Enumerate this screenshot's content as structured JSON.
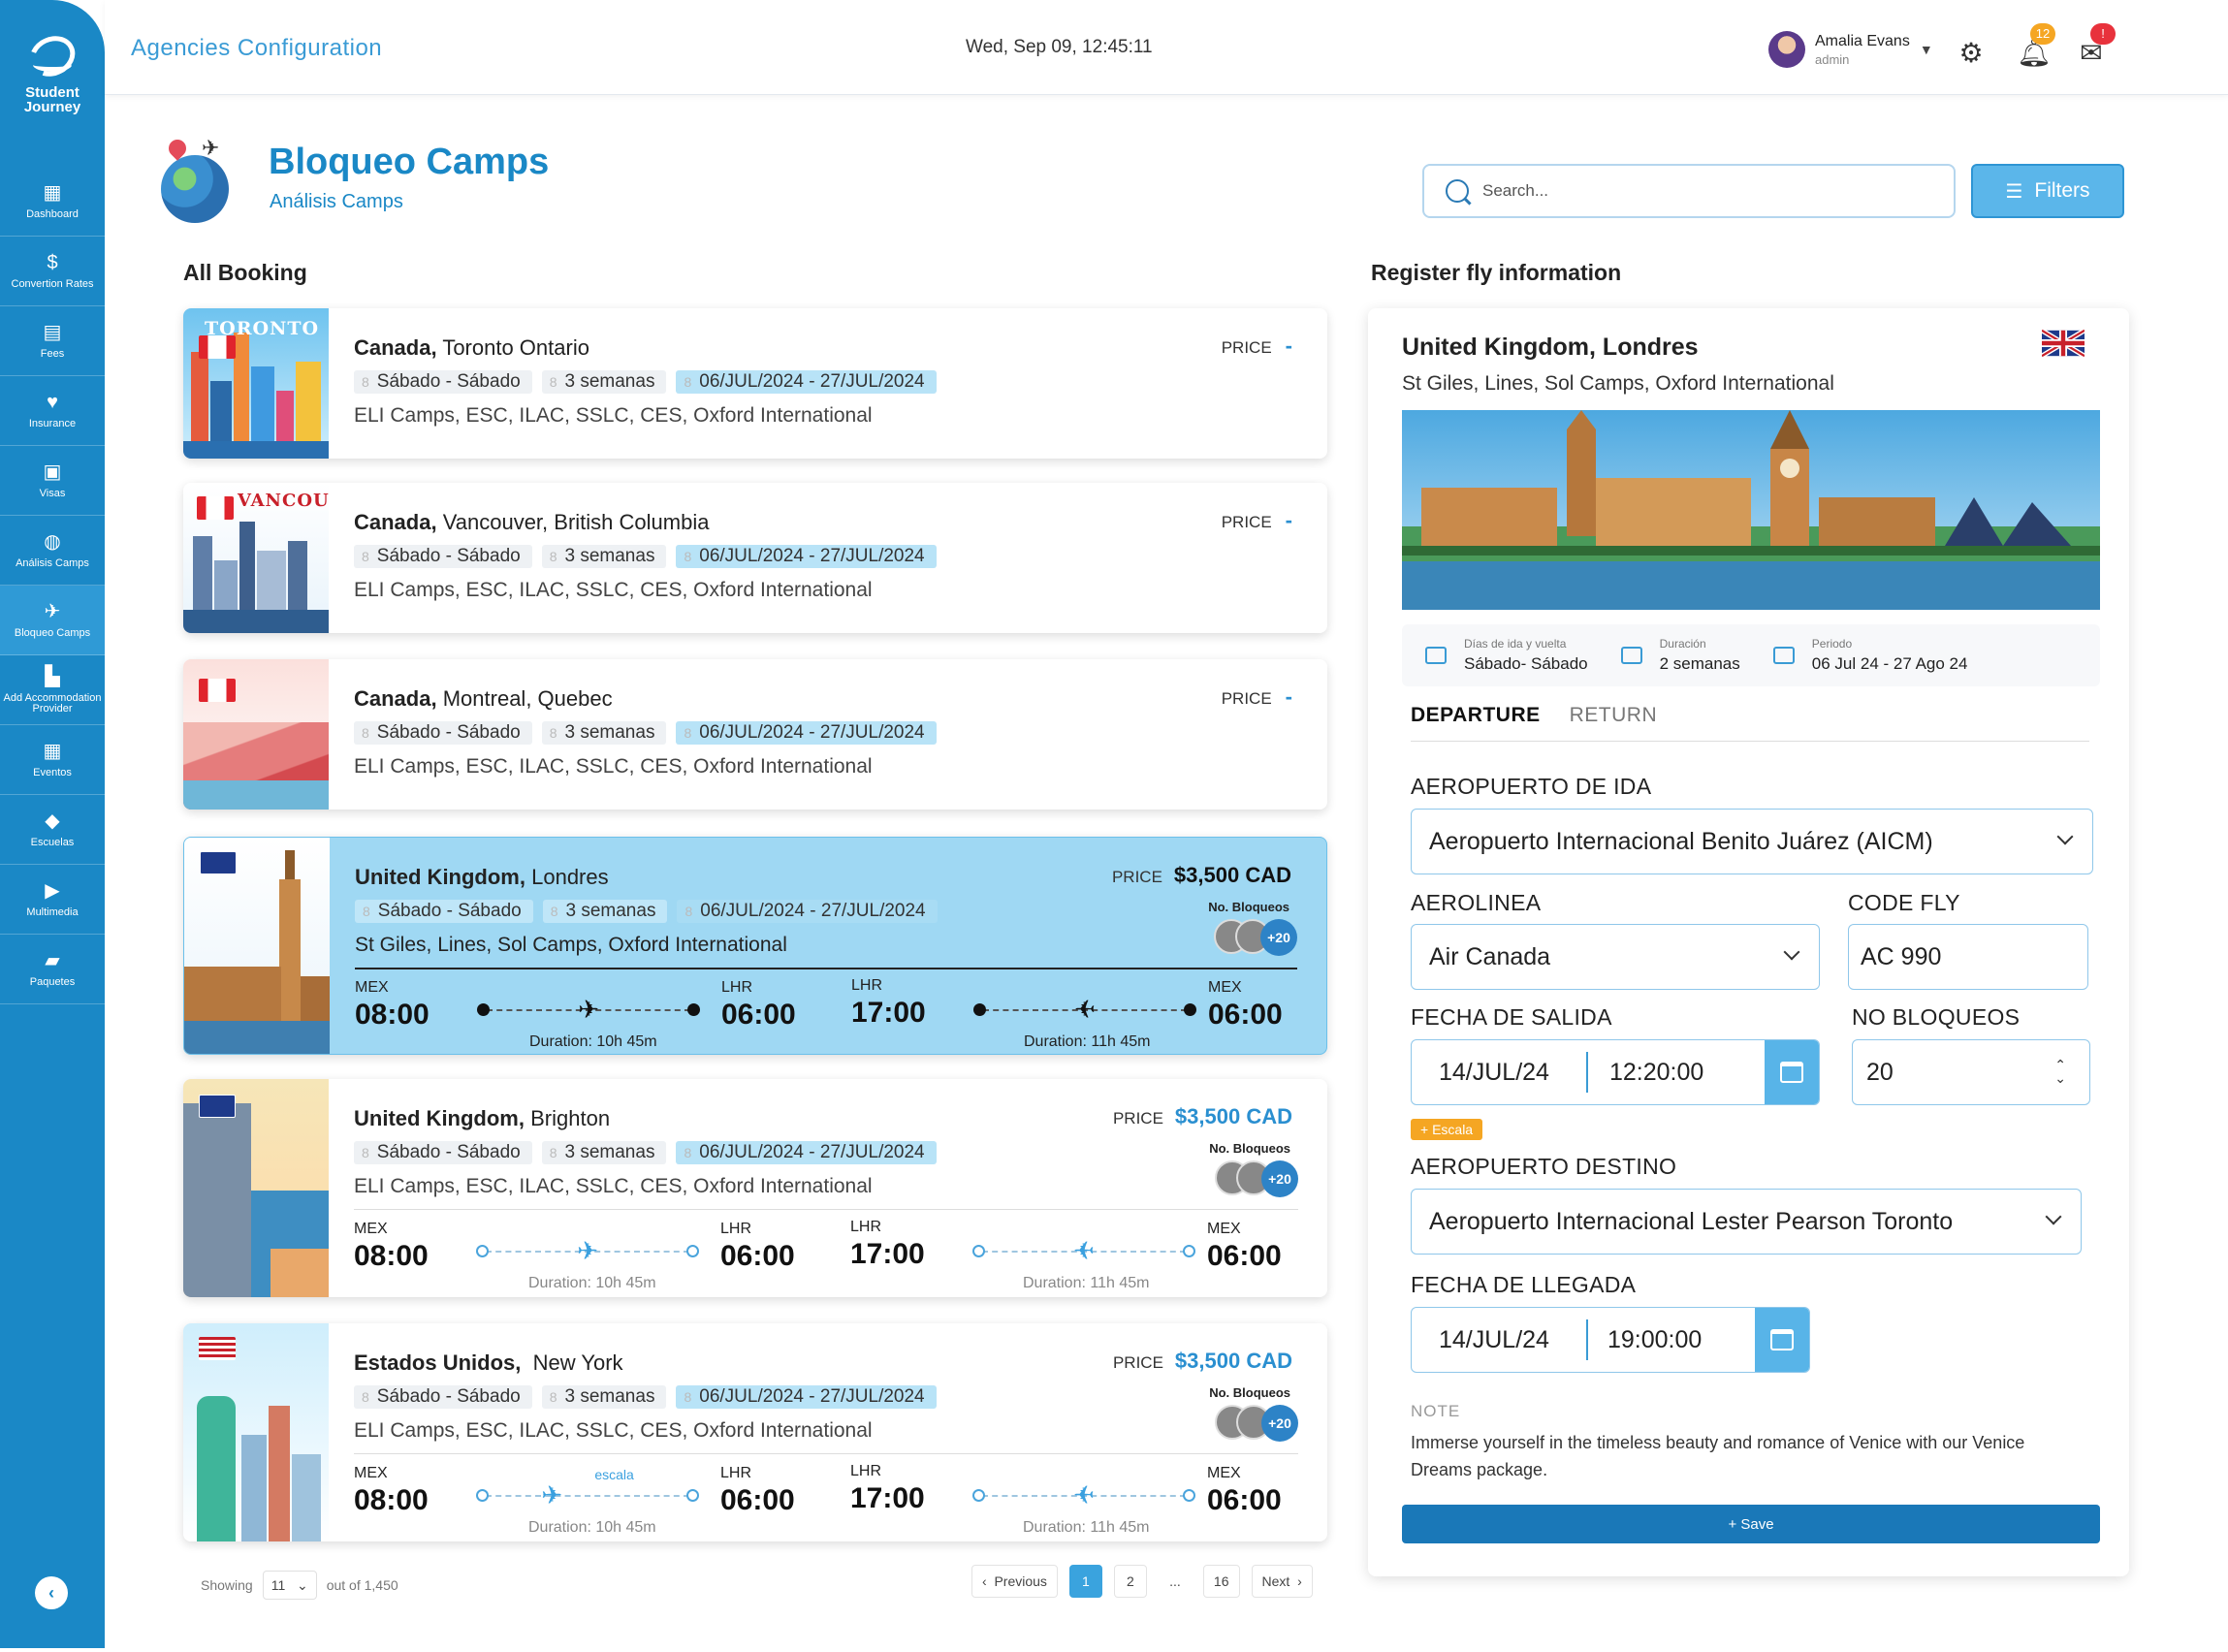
{
  "app": {
    "name": "Student Journey",
    "top_title": "Agencies Configuration",
    "datetime": "Wed, Sep 09, 12:45:11"
  },
  "sidebar": {
    "items": [
      {
        "label": "Dashboard",
        "icon": "dashboard-icon"
      },
      {
        "label": "Convertion Rates",
        "icon": "dollar-icon"
      },
      {
        "label": "Fees",
        "icon": "fees-icon"
      },
      {
        "label": "Insurance",
        "icon": "insurance-icon"
      },
      {
        "label": "Visas",
        "icon": "visa-icon"
      },
      {
        "label": "Análisis Camps",
        "icon": "globe-icon"
      },
      {
        "label": "Bloqueo Camps",
        "icon": "plane-icon",
        "active": true
      },
      {
        "label": "Add Accommodation Provider",
        "icon": "building-icon"
      },
      {
        "label": "Eventos",
        "icon": "calendar-icon"
      },
      {
        "label": "Escuelas",
        "icon": "graduation-icon"
      },
      {
        "label": "Multimedia",
        "icon": "multimedia-icon"
      },
      {
        "label": "Paquetes",
        "icon": "package-icon"
      }
    ]
  },
  "user": {
    "name": "Amalia Evans",
    "role": "admin"
  },
  "notifications": {
    "bell_count": "12",
    "mail_badge": "!"
  },
  "language": "EN",
  "page": {
    "title": "Bloqueo Camps",
    "subtitle": "Análisis Camps"
  },
  "search": {
    "placeholder": "Search..."
  },
  "filters_label": "Filters",
  "bookings_title": "All Booking",
  "bookings": [
    {
      "country": "Canada,",
      "city": "Toronto Ontario",
      "days": "Sábado - Sábado",
      "duration": "3 semanas",
      "dates": "06/JUL/2024 - 27/JUL/2024",
      "schools": "ELI Camps, ESC, ILAC, SSLC, CES, Oxford International",
      "price_label": "PRICE",
      "price": "-",
      "thumb_label": "TORONTO"
    },
    {
      "country": "Canada,",
      "city": "Vancouver, British Columbia",
      "days": "Sábado - Sábado",
      "duration": "3 semanas",
      "dates": "06/JUL/2024 - 27/JUL/2024",
      "schools": "ELI Camps, ESC, ILAC, SSLC, CES, Oxford International",
      "price_label": "PRICE",
      "price": "-",
      "thumb_label": "VANCOUVER"
    },
    {
      "country": "Canada,",
      "city": "Montreal, Quebec",
      "days": "Sábado - Sábado",
      "duration": "3 semanas",
      "dates": "06/JUL/2024 - 27/JUL/2024",
      "schools": "ELI Camps, ESC, ILAC, SSLC, CES, Oxford International",
      "price_label": "PRICE",
      "price": "-"
    },
    {
      "country": "United Kingdom,",
      "city": "Londres",
      "days": "Sábado - Sábado",
      "duration": "3 semanas",
      "dates": "06/JUL/2024 - 27/JUL/2024",
      "schools": "St Giles, Lines, Sol Camps, Oxford International",
      "price_label": "PRICE",
      "price": "$3,500 CAD",
      "bloq_label": "No. Bloqueos",
      "bloq_more": "+20",
      "out": {
        "from": "MEX",
        "from_time": "08:00",
        "to": "LHR",
        "to_time": "06:00",
        "duration": "Duration: 10h 45m"
      },
      "ret": {
        "from": "LHR",
        "from_time": "17:00",
        "to": "MEX",
        "to_time": "06:00",
        "duration": "Duration: 11h 45m"
      }
    },
    {
      "country": "United Kingdom,",
      "city": "Brighton",
      "days": "Sábado - Sábado",
      "duration": "3 semanas",
      "dates": "06/JUL/2024 - 27/JUL/2024",
      "schools": "ELI Camps, ESC, ILAC, SSLC, CES, Oxford International",
      "price_label": "PRICE",
      "price": "$3,500 CAD",
      "bloq_label": "No. Bloqueos",
      "bloq_more": "+20",
      "out": {
        "from": "MEX",
        "from_time": "08:00",
        "to": "LHR",
        "to_time": "06:00",
        "duration": "Duration: 10h 45m"
      },
      "ret": {
        "from": "LHR",
        "from_time": "17:00",
        "to": "MEX",
        "to_time": "06:00",
        "duration": "Duration: 11h 45m"
      }
    },
    {
      "country": "Estados Unidos,",
      "city": "New York",
      "days": "Sábado - Sábado",
      "duration": "3 semanas",
      "dates": "06/JUL/2024 - 27/JUL/2024",
      "schools": "ELI Camps, ESC, ILAC, SSLC, CES, Oxford International",
      "price_label": "PRICE",
      "price": "$3,500 CAD",
      "bloq_label": "No. Bloqueos",
      "bloq_more": "+20",
      "stop_label": "escala",
      "out": {
        "from": "MEX",
        "from_time": "08:00",
        "to": "LHR",
        "to_time": "06:00",
        "duration": "Duration: 10h 45m"
      },
      "ret": {
        "from": "LHR",
        "from_time": "17:00",
        "to": "MEX",
        "to_time": "06:00",
        "duration": "Duration: 11h 45m"
      }
    }
  ],
  "pagination": {
    "showing": "Showing",
    "per_page": "11",
    "out_of": "out of 1,450",
    "previous": "Previous",
    "pages": [
      "1",
      "2",
      "...",
      "16"
    ],
    "next": "Next"
  },
  "register": {
    "section_title": "Register fly information",
    "title": "United Kingdom, Londres",
    "subtitle": "St Giles, Lines, Sol Camps, Oxford International",
    "info": [
      {
        "label": "Días de ida y vuelta",
        "value": "Sábado- Sábado"
      },
      {
        "label": "Duración",
        "value": "2 semanas"
      },
      {
        "label": "Periodo",
        "value": "06 Jul 24 - 27 Ago 24"
      }
    ],
    "tabs": [
      "DEPARTURE",
      "RETURN"
    ],
    "fields": {
      "departure_airport_label": "AEROPUERTO DE IDA",
      "departure_airport": "Aeropuerto Internacional Benito Juárez (AICM)",
      "airline_label": "AEROLINEA",
      "airline": "Air Canada",
      "code_label": "CODE FLY",
      "code": "AC 990",
      "departure_date_label": "FECHA DE SALIDA",
      "departure_date": "14/JUL/24",
      "departure_time": "12:20:00",
      "blocks_label": "NO BLOQUEOS",
      "blocks": "20",
      "stop_tag": "+ Escala",
      "dest_airport_label": "AEROPUERTO DESTINO",
      "dest_airport": "Aeropuerto Internacional Lester Pearson Toronto",
      "arrival_date_label": "FECHA DE LLEGADA",
      "arrival_date": "14/JUL/24",
      "arrival_time": "19:00:00"
    },
    "note_label": "NOTE",
    "note": "Immerse yourself in the timeless beauty and romance of Venice with our Venice Dreams package.",
    "save": "+ Save"
  }
}
